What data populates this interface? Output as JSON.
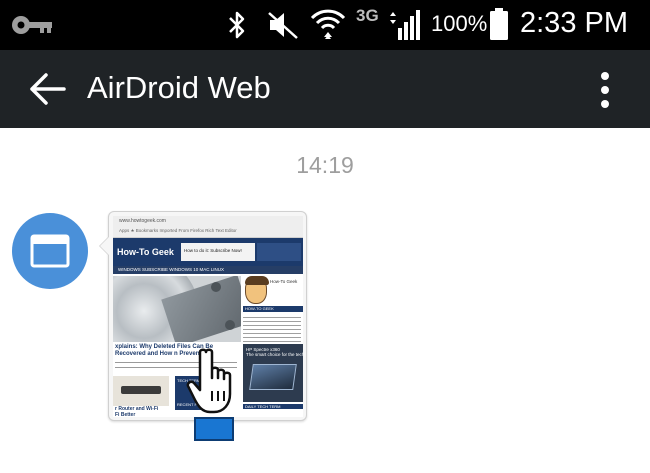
{
  "status_bar": {
    "network_type": "3G",
    "battery_percent": "100%",
    "time": "2:33 PM",
    "icons": [
      "key-icon",
      "bluetooth-icon",
      "mute-icon",
      "wifi-icon",
      "signal-icon",
      "battery-icon"
    ]
  },
  "app_bar": {
    "title": "AirDroid Web",
    "back_icon": "arrow-back-icon",
    "menu_icon": "more-vert-icon"
  },
  "chat": {
    "timestamp": "14:19",
    "avatar_icon": "browser-window-icon",
    "accent_color": "#4a90d9",
    "message": {
      "type": "screenshot-thumbnail",
      "thumbnail": {
        "url": "www.howtogeek.com",
        "bookmarks": "Apps  ★ Bookmarks  Imported From Firefox  Rich Text Editor",
        "logo": "How-To Geek",
        "banner": "How to do it: Subscribe Now!",
        "nav": "WINDOWS  SUBSCRIBE  WINDOWS 10  MAC  LINUX",
        "headline": "xplains: Why Deleted Files Can Be Recovered and How n Prevent It",
        "author": "How-To Geek",
        "side_heading": "HOW-TO GEEK",
        "ad_text": "HP Spectre x360\nThe smart choice for the tech",
        "router_caption": "r Router and Wi-Fi\nFi Better",
        "tech_heading": "TECH TERM",
        "tech_heading_2": "RECENT PICKS",
        "side_heading_2": "DAILY TECH TERM"
      }
    },
    "cursor_icon": "hand-pointer-icon"
  }
}
